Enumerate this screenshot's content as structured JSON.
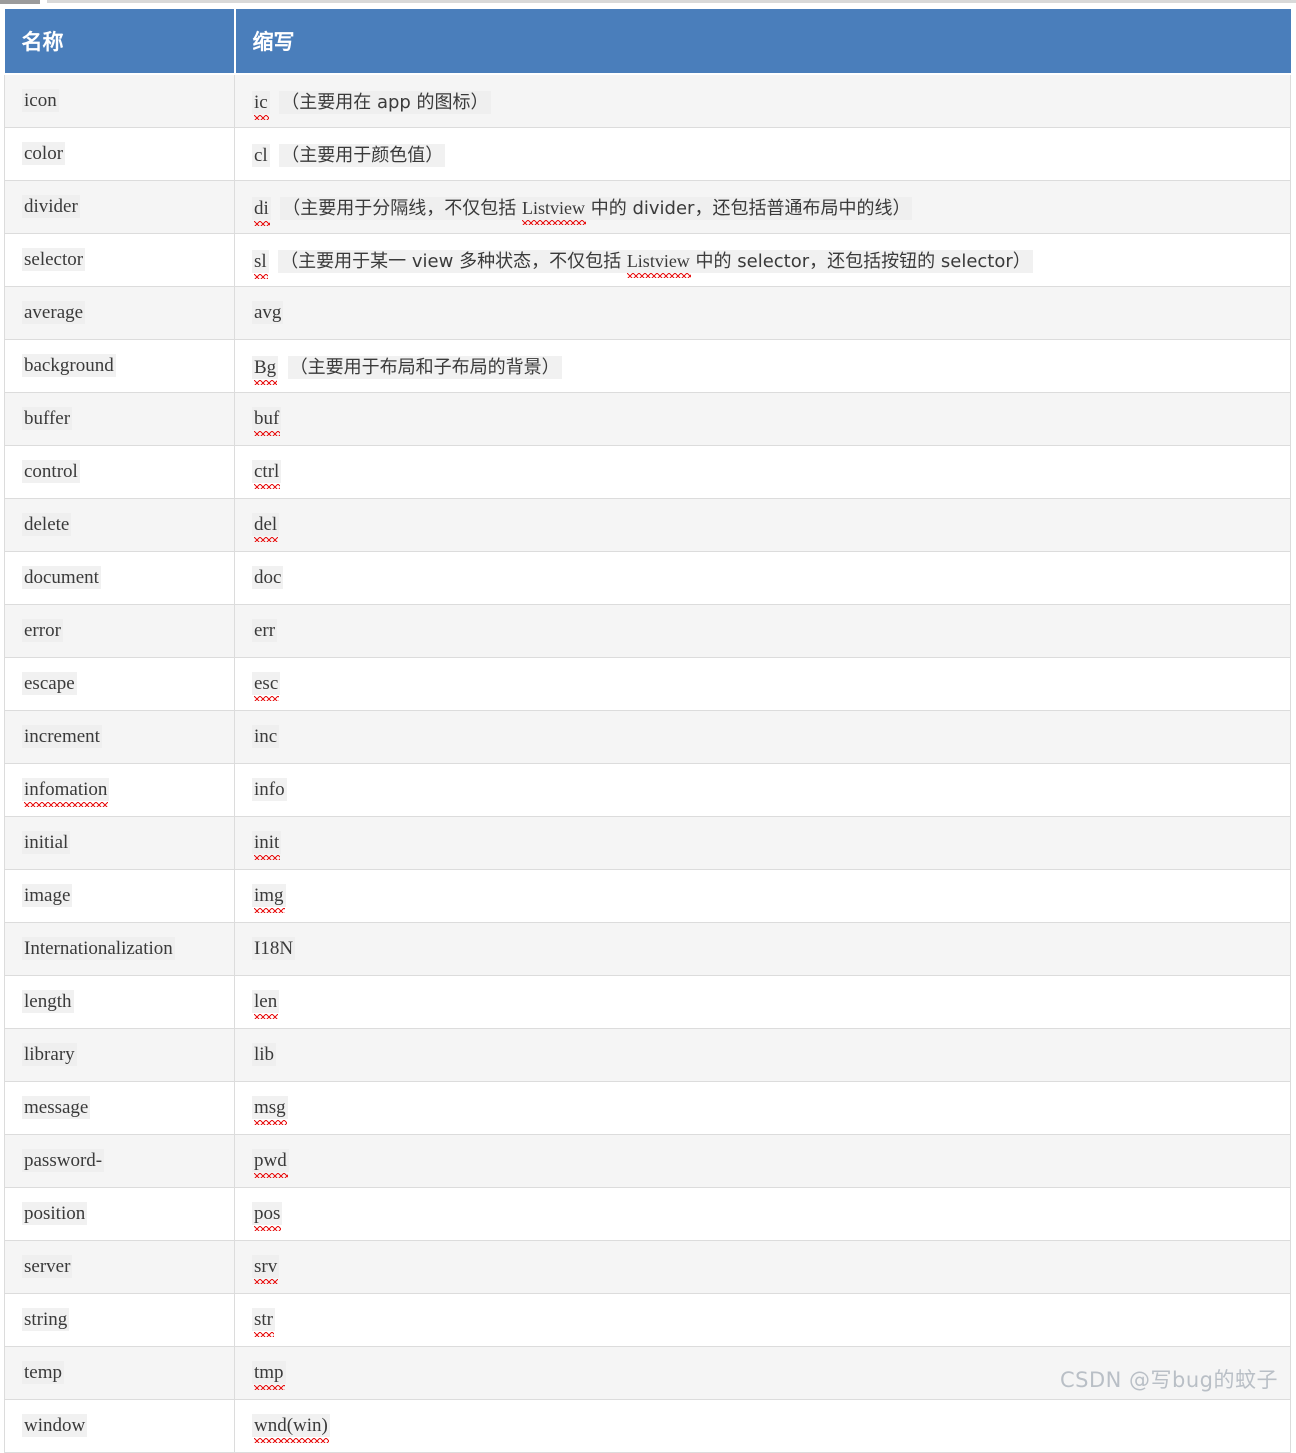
{
  "table": {
    "columns": [
      {
        "key": "name",
        "label": "名称"
      },
      {
        "key": "abbr",
        "label": "缩写"
      }
    ],
    "rows": [
      {
        "name": "icon",
        "name_misspelled": false,
        "abbr": "ic",
        "abbr_misspelled": true,
        "note": "（主要用在 app 的图标）"
      },
      {
        "name": "color",
        "name_misspelled": false,
        "abbr": "cl",
        "abbr_misspelled": false,
        "note": "（主要用于颜色值）"
      },
      {
        "name": "divider",
        "name_misspelled": false,
        "abbr": "di",
        "abbr_misspelled": true,
        "note": "（主要用于分隔线，不仅包括 Listview 中的 divider，还包括普通布局中的线）"
      },
      {
        "name": "selector",
        "name_misspelled": false,
        "abbr": "sl",
        "abbr_misspelled": true,
        "note": "（主要用于某一 view 多种状态，不仅包括 Listview 中的 selector，还包括按钮的 selector）"
      },
      {
        "name": "average",
        "name_misspelled": false,
        "abbr": "avg",
        "abbr_misspelled": false,
        "note": ""
      },
      {
        "name": "background",
        "name_misspelled": false,
        "abbr": "Bg",
        "abbr_misspelled": true,
        "note": "（主要用于布局和子布局的背景）"
      },
      {
        "name": "buffer",
        "name_misspelled": false,
        "abbr": "buf",
        "abbr_misspelled": true,
        "note": ""
      },
      {
        "name": "control",
        "name_misspelled": false,
        "abbr": "ctrl",
        "abbr_misspelled": true,
        "note": ""
      },
      {
        "name": "delete",
        "name_misspelled": false,
        "abbr": "del",
        "abbr_misspelled": true,
        "note": ""
      },
      {
        "name": "document",
        "name_misspelled": false,
        "abbr": "doc",
        "abbr_misspelled": false,
        "note": ""
      },
      {
        "name": "error",
        "name_misspelled": false,
        "abbr": "err",
        "abbr_misspelled": false,
        "note": ""
      },
      {
        "name": "escape",
        "name_misspelled": false,
        "abbr": "esc",
        "abbr_misspelled": true,
        "note": ""
      },
      {
        "name": "increment",
        "name_misspelled": false,
        "abbr": "inc",
        "abbr_misspelled": false,
        "note": ""
      },
      {
        "name": "infomation",
        "name_misspelled": true,
        "abbr": "info",
        "abbr_misspelled": false,
        "note": ""
      },
      {
        "name": "initial",
        "name_misspelled": false,
        "abbr": "init",
        "abbr_misspelled": true,
        "note": ""
      },
      {
        "name": "image",
        "name_misspelled": false,
        "abbr": "img",
        "abbr_misspelled": true,
        "note": ""
      },
      {
        "name": "Internationalization",
        "name_misspelled": false,
        "abbr": "I18N",
        "abbr_misspelled": false,
        "note": ""
      },
      {
        "name": "length",
        "name_misspelled": false,
        "abbr": "len",
        "abbr_misspelled": true,
        "note": ""
      },
      {
        "name": "library",
        "name_misspelled": false,
        "abbr": "lib",
        "abbr_misspelled": false,
        "note": ""
      },
      {
        "name": "message",
        "name_misspelled": false,
        "abbr": "msg",
        "abbr_misspelled": true,
        "note": ""
      },
      {
        "name": "password-",
        "name_misspelled": false,
        "abbr": "pwd",
        "abbr_misspelled": true,
        "note": ""
      },
      {
        "name": "position",
        "name_misspelled": false,
        "abbr": "pos",
        "abbr_misspelled": true,
        "note": ""
      },
      {
        "name": "server",
        "name_misspelled": false,
        "abbr": "srv",
        "abbr_misspelled": true,
        "note": ""
      },
      {
        "name": "string",
        "name_misspelled": false,
        "abbr": "str",
        "abbr_misspelled": true,
        "note": ""
      },
      {
        "name": "temp",
        "name_misspelled": false,
        "abbr": "tmp",
        "abbr_misspelled": true,
        "note": ""
      },
      {
        "name": "window",
        "name_misspelled": false,
        "abbr": "wnd(win)",
        "abbr_misspelled": true,
        "note": ""
      }
    ]
  },
  "watermark": {
    "text": "CSDN @写bug的蚊子"
  },
  "colors": {
    "header_bg": "#4a7ebb",
    "header_text": "#ffffff",
    "row_shade": "#f5f5f5",
    "row_plain": "#ffffff",
    "border": "#dcdcdc",
    "body_text": "#3a3a3a",
    "spellcheck": "#e81818",
    "watermark_text": "#b9bfc6"
  }
}
